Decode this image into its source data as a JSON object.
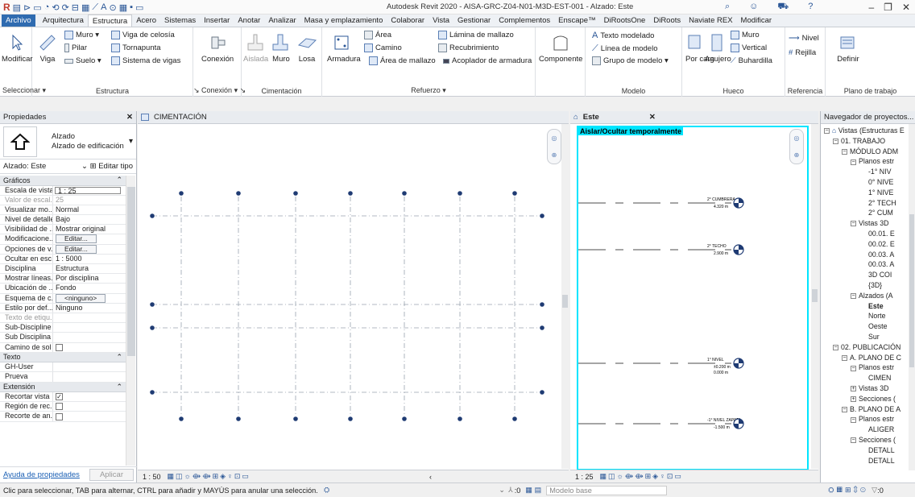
{
  "titlebar": {
    "app_title": "Autodesk Revit 2020 - AISA-GRC-Z04-N01-M3D-EST-001 - Alzado: Este",
    "qat_icons": [
      "R",
      "▤",
      "⊳",
      "▭",
      "◔",
      "⟲",
      "⟳",
      "⊟",
      "▦",
      "⟋",
      "A",
      "⊙",
      "▦",
      "▪",
      "▭"
    ]
  },
  "tabs": [
    "Archivo",
    "Arquitectura",
    "Estructura",
    "Acero",
    "Sistemas",
    "Insertar",
    "Anotar",
    "Analizar",
    "Masa y emplazamiento",
    "Colaborar",
    "Vista",
    "Gestionar",
    "Complementos",
    "Enscape™",
    "DiRootsOne",
    "DiRoots",
    "Naviate REX",
    "Modificar"
  ],
  "active_tab": "Estructura",
  "ribbon": {
    "seleccionar": {
      "modificar": "Modificar",
      "label": "Seleccionar ▾"
    },
    "estructura": {
      "viga": "Viga",
      "muro": "Muro ▾",
      "pilar": "Pilar",
      "suelo": "Suelo ▾",
      "viga_celosia": "Viga de celosía",
      "tornapunta": "Tornapunta",
      "sistema_vigas": "Sistema de vigas",
      "label": "Estructura"
    },
    "conexion": {
      "conexion": "Conexión",
      "label": "↘ Conexión ▾ ↘"
    },
    "cimentacion": {
      "aislada": "Aislada",
      "muro": "Muro",
      "losa": "Losa",
      "label": "Cimentación"
    },
    "refuerzo": {
      "armadura": "Armadura",
      "area": "Área",
      "camino": "Camino",
      "lamina": "Lámina de mallazo",
      "recubrimiento": "Recubrimiento",
      "area_mallazo": "Área de mallazo",
      "acoplador": "Acoplador de armadura",
      "label": "Refuerzo ▾"
    },
    "componente": {
      "label": "Componente"
    },
    "modelo": {
      "texto": "Texto modelado",
      "linea": "Línea de modelo",
      "grupo": "Grupo de modelo ▾",
      "label": "Modelo"
    },
    "hueco": {
      "por_cara": "Por cara",
      "agujero": "Agujero",
      "muro": "Muro",
      "vertical": "Vertical",
      "buhardilla": "Buhardilla",
      "label": "Hueco"
    },
    "referencia": {
      "nivel": "Nivel",
      "rejilla": "Rejilla",
      "label": "Referencia"
    },
    "plano": {
      "definir": "Definir",
      "label": "Plano de trabajo"
    }
  },
  "properties": {
    "title": "Propiedades",
    "type_line1": "Alzado",
    "type_line2": "Alzado de edificación",
    "instance": "Alzado: Este",
    "edit_type": "Editar tipo",
    "groups": {
      "graficos": "Gráficos",
      "texto": "Texto",
      "extension": "Extensión"
    },
    "rows": [
      {
        "k": "Escala de vista",
        "v": "1 : 25"
      },
      {
        "k": "Valor de escal...",
        "v": "25"
      },
      {
        "k": "Visualizar mo...",
        "v": "Normal"
      },
      {
        "k": "Nivel de detalle",
        "v": "Bajo"
      },
      {
        "k": "Visibilidad de ...",
        "v": "Mostrar original"
      },
      {
        "k": "Modificacione...",
        "v": "Editar..."
      },
      {
        "k": "Opciones de v...",
        "v": "Editar..."
      },
      {
        "k": "Ocultar en esc...",
        "v": "1 : 5000"
      },
      {
        "k": "Disciplina",
        "v": "Estructura"
      },
      {
        "k": "Mostrar líneas...",
        "v": "Por disciplina"
      },
      {
        "k": "Ubicación de ...",
        "v": "Fondo"
      },
      {
        "k": "Esquema de c...",
        "v": "<ninguno>"
      },
      {
        "k": "Estilo por def...",
        "v": "Ninguno"
      },
      {
        "k": "Texto de etiqu...",
        "v": ""
      },
      {
        "k": "Sub-Discipline",
        "v": ""
      },
      {
        "k": "Sub Disciplina",
        "v": ""
      },
      {
        "k": "Camino de sol",
        "v": ""
      }
    ],
    "text_rows": [
      {
        "k": "GH-User",
        "v": ""
      },
      {
        "k": "Prueva",
        "v": ""
      }
    ],
    "ext_rows": [
      {
        "k": "Recortar vista",
        "v": "✓"
      },
      {
        "k": "Región de rec...",
        "v": ""
      },
      {
        "k": "Recorte de an...",
        "v": ""
      }
    ],
    "help_link": "Ayuda de propiedades",
    "apply": "Aplicar"
  },
  "view1": {
    "tab": "CIMENTACIÓN",
    "scale": "1 : 50"
  },
  "view2": {
    "tab": "Este",
    "banner": "Aislar/Ocultar temporalmente",
    "scale": "1 : 25",
    "levels": [
      {
        "name": "2° CUMBRERA",
        "elev": "4.320 m"
      },
      {
        "name": "2° TECHO",
        "elev": "2.900 m"
      },
      {
        "name": "1° NIVEL",
        "elev": "±0.200 m",
        "elev2": "0.000 m"
      },
      {
        "name": "-1° NIVEL ZAPATA",
        "elev": "-1.500 m"
      }
    ]
  },
  "navigator": {
    "title": "Navegador de proyectos...",
    "items": [
      {
        "t": "Vistas (Estructuras E",
        "d": 0,
        "tg": "−"
      },
      {
        "t": "01. TRABAJO",
        "d": 1,
        "tg": "−"
      },
      {
        "t": "MÓDULO ADM",
        "d": 2,
        "tg": "−"
      },
      {
        "t": "Planos estr",
        "d": 3,
        "tg": "−"
      },
      {
        "t": "-1° NIV",
        "d": 4,
        "tg": ""
      },
      {
        "t": "0° NIVE",
        "d": 4,
        "tg": ""
      },
      {
        "t": "1° NIVE",
        "d": 4,
        "tg": ""
      },
      {
        "t": "2° TECH",
        "d": 4,
        "tg": ""
      },
      {
        "t": "2° CUM",
        "d": 4,
        "tg": ""
      },
      {
        "t": "Vistas 3D",
        "d": 3,
        "tg": "−"
      },
      {
        "t": "00.01. E",
        "d": 4,
        "tg": ""
      },
      {
        "t": "00.02. E",
        "d": 4,
        "tg": ""
      },
      {
        "t": "00.03. A",
        "d": 4,
        "tg": ""
      },
      {
        "t": "00.03. A",
        "d": 4,
        "tg": ""
      },
      {
        "t": "3D COI",
        "d": 4,
        "tg": ""
      },
      {
        "t": "{3D}",
        "d": 4,
        "tg": ""
      },
      {
        "t": "Alzados (A",
        "d": 3,
        "tg": "−"
      },
      {
        "t": "Este",
        "d": 4,
        "tg": "",
        "sel": true
      },
      {
        "t": "Norte",
        "d": 4,
        "tg": ""
      },
      {
        "t": "Oeste",
        "d": 4,
        "tg": ""
      },
      {
        "t": "Sur",
        "d": 4,
        "tg": ""
      },
      {
        "t": "02. PUBLICACIÓN",
        "d": 1,
        "tg": "−"
      },
      {
        "t": "A. PLANO DE C",
        "d": 2,
        "tg": "−"
      },
      {
        "t": "Planos estr",
        "d": 3,
        "tg": "−"
      },
      {
        "t": "CIMEN",
        "d": 4,
        "tg": ""
      },
      {
        "t": "Vistas 3D",
        "d": 3,
        "tg": "+"
      },
      {
        "t": "Secciones (",
        "d": 3,
        "tg": "+"
      },
      {
        "t": "B. PLANO DE A",
        "d": 2,
        "tg": "−"
      },
      {
        "t": "Planos estr",
        "d": 3,
        "tg": "−"
      },
      {
        "t": "ALIGER",
        "d": 4,
        "tg": ""
      },
      {
        "t": "Secciones (",
        "d": 3,
        "tg": "−"
      },
      {
        "t": "DETALL",
        "d": 4,
        "tg": ""
      },
      {
        "t": "DETALL",
        "d": 4,
        "tg": ""
      }
    ]
  },
  "statusbar": {
    "hint": "Clic para seleccionar, TAB para alternar, CTRL para añadir y MAYÚS para anular una selección.",
    "zero": ":0",
    "model": "Modelo base",
    "filter": ":0"
  },
  "colors": {
    "accent": "#2f6bb0",
    "cyan": "#00e5ff",
    "grid": "#1f3b73"
  }
}
